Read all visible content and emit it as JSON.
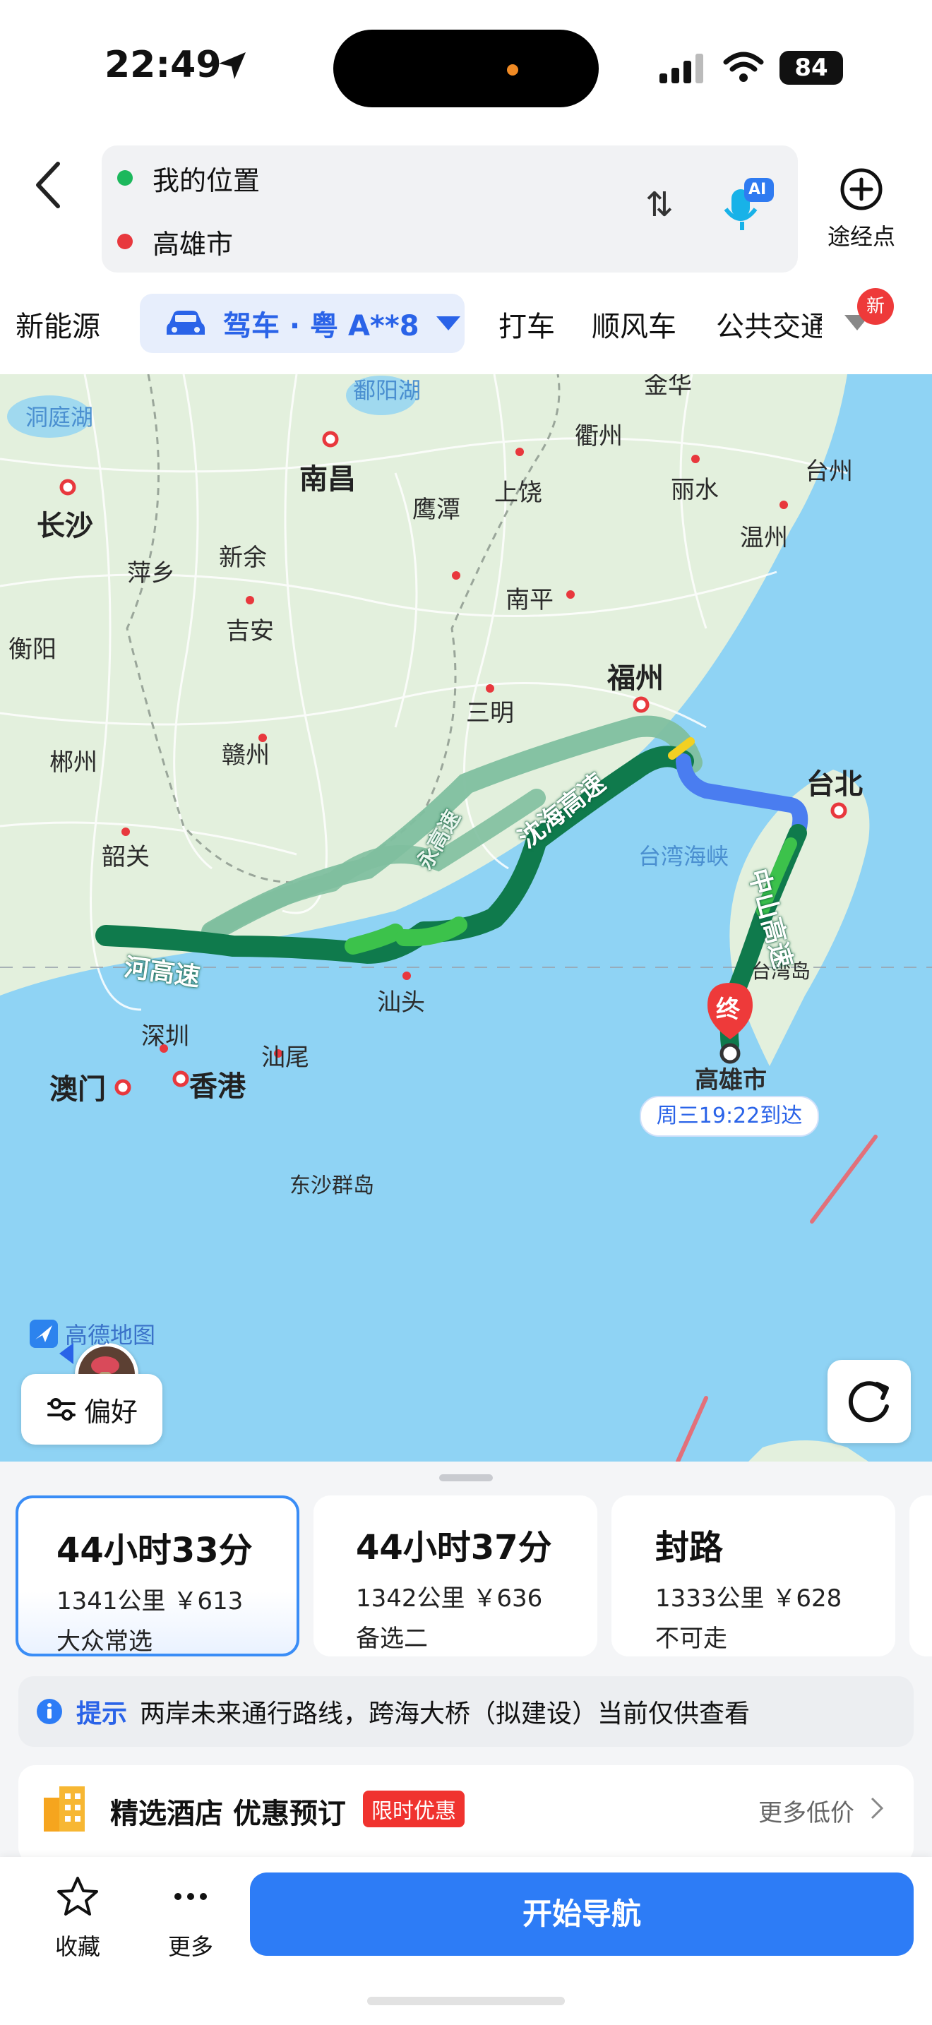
{
  "status_bar": {
    "time": "22:49",
    "battery": "84"
  },
  "header": {
    "origin": "我的位置",
    "destination": "高雄市",
    "ai_label": "AI",
    "waypoint_label": "途经点"
  },
  "modes": {
    "new_energy": "新能源",
    "drive": "驾车 · 粤 A**8",
    "taxi": "打车",
    "carpool": "顺风车",
    "transit": "公共交通",
    "badge": "新"
  },
  "map": {
    "places": [
      "洞庭湖",
      "鄱阳湖",
      "金华",
      "衢州",
      "台州",
      "南昌",
      "鹰潭",
      "上饶",
      "丽水",
      "温州",
      "长沙",
      "萍乡",
      "新余",
      "南平",
      "衡阳",
      "吉安",
      "福州",
      "三明",
      "郴州",
      "赣州",
      "台北",
      "韶关",
      "台湾海峡",
      "台湾岛",
      "汕头",
      "深圳",
      "汕尾",
      "澳门",
      "香港",
      "东沙群岛",
      "高雄市"
    ],
    "roads": [
      "沈海高速",
      "中山高速",
      "河高速",
      "永高速"
    ],
    "destination_marker": "终",
    "arrival": "周三19:22到达",
    "logo": "高德地图",
    "preference_button": "偏好",
    "colors": {
      "route_main": "#0f7a4c",
      "route_alt": "#7fbf9f",
      "sea": "#8fd3f4",
      "bridge": "#4a7df0"
    }
  },
  "routes": [
    {
      "time": "44小时33分",
      "detail": "1341公里 ￥613",
      "tag": "大众常选",
      "selected": true
    },
    {
      "time": "44小时37分",
      "detail": "1342公里 ￥636",
      "tag": "备选二",
      "selected": false
    },
    {
      "time": "封路",
      "detail": "1333公里 ￥628",
      "tag": "不可走",
      "selected": false
    }
  ],
  "tip": {
    "label": "提示",
    "text": "两岸未来通行路线，跨海大桥（拟建设）当前仅供查看"
  },
  "hotel": {
    "title": "精选酒店 优惠预订",
    "badge": "限时优惠",
    "more": "更多低价"
  },
  "bottom_bar": {
    "favorite": "收藏",
    "more": "更多",
    "start": "开始导航"
  }
}
